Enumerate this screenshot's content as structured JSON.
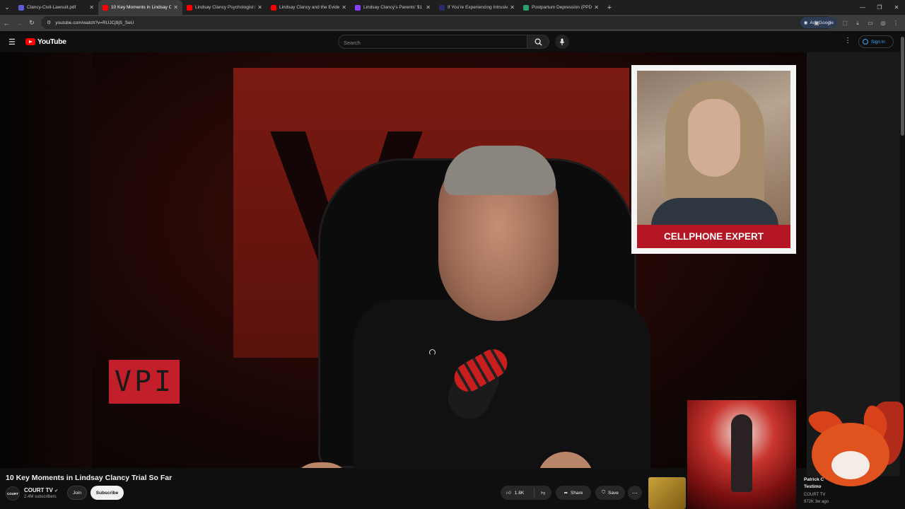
{
  "browser": {
    "tabs": [
      {
        "label": "Clancy-Civil-Lawsuit.pdf",
        "favicon_color": "#5b5bd6",
        "active": false
      },
      {
        "label": "10 Key Moments in Lindsay Cl",
        "favicon_color": "#ff0000",
        "active": true
      },
      {
        "label": "Lindsay Clancy Psychologist D",
        "favicon_color": "#ff0000",
        "active": false
      },
      {
        "label": "Lindsay Clancy and the Eviden",
        "favicon_color": "#ff0000",
        "active": false
      },
      {
        "label": "Lindsay Clancy's Parents' $1 M",
        "favicon_color": "#8a3ffc",
        "active": false
      },
      {
        "label": "If You're Experiencing Intrusiv",
        "favicon_color": "#2a2a6a",
        "active": false
      },
      {
        "label": "Postpartum Depression (PPD)",
        "favicon_color": "#2f9e6f",
        "active": false
      }
    ],
    "url": "youtube.com/watch?v=RUJCj9jS_SeU",
    "ask_google_label": "Ask Google"
  },
  "youtube": {
    "logo_text": "YouTube",
    "search_placeholder": "Search",
    "signin_label": "Sign in"
  },
  "video": {
    "overlay_logo": "VPI",
    "inset_caption": "CELLPHONE EXPERT",
    "title": "10 Key Moments in Lindsay Clancy Trial So Far",
    "channel_name": "COURT TV",
    "channel_avatar_text": "COURT",
    "subscribers": "2.4M subscribers",
    "join_label": "Join",
    "subscribe_label": "Subscribe",
    "likes": "1.8K",
    "share_label": "Share",
    "save_label": "Save"
  },
  "recommended": {
    "title_line1": "Patrick C",
    "title_line2": "Testimo",
    "channel": "COURT TV",
    "meta": "972K  3w ago"
  },
  "colors": {
    "youtube_red": "#ff0000",
    "link_blue": "#3ea6ff",
    "caption_red": "#b51624"
  }
}
